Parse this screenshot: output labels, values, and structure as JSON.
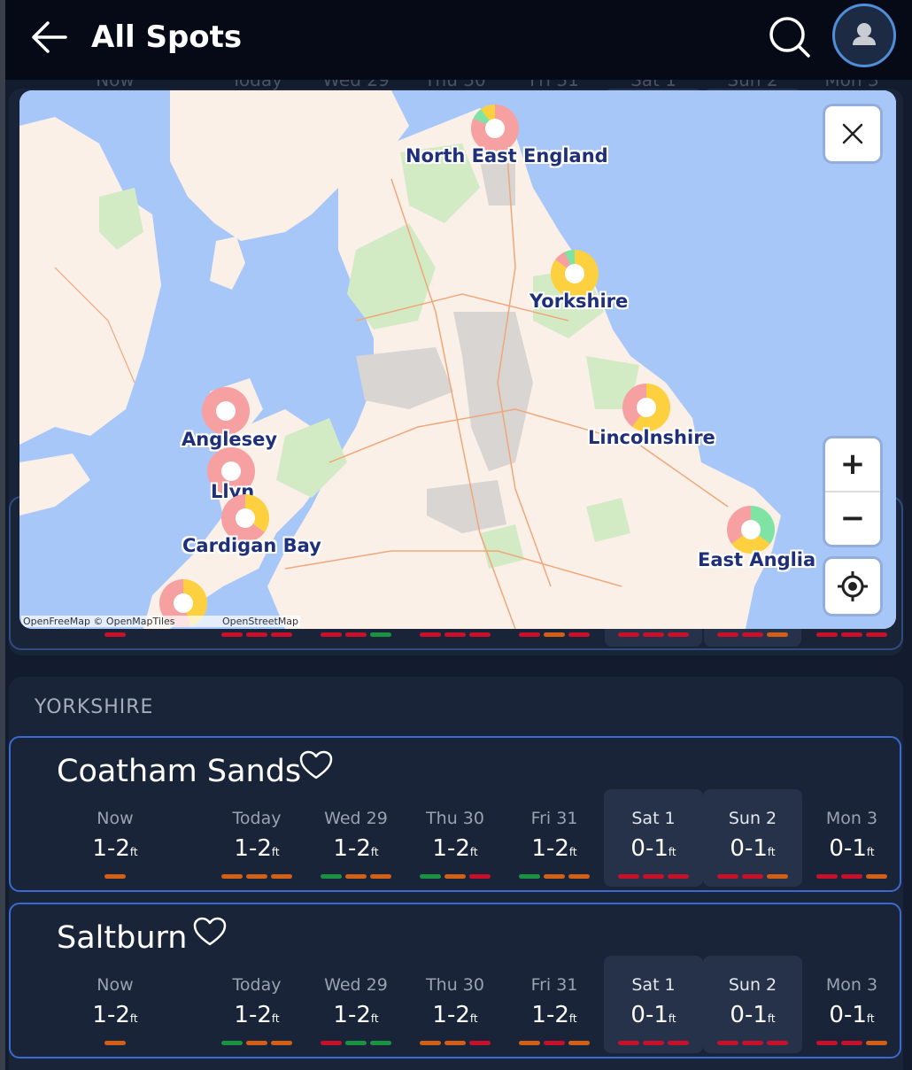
{
  "header": {
    "title": "All Spots"
  },
  "day_columns": [
    "Now",
    "Today",
    "Wed 29",
    "Thu 30",
    "Fri 31",
    "Sat 1",
    "Sun 2",
    "Mon 3"
  ],
  "colors": {
    "red": "#c8102a",
    "orange": "#d35f14",
    "green": "#1a9340",
    "marker_pink": "#f7a0a2",
    "marker_yellow": "#fcd03f",
    "marker_green": "#7fe3a4",
    "accent": "#3a6ad0"
  },
  "prev_group_bars": [
    [
      "red"
    ],
    [
      "red",
      "red",
      "red"
    ],
    [
      "red",
      "red",
      "green"
    ],
    [
      "red",
      "red",
      "red"
    ],
    [
      "red",
      "orange",
      "red"
    ],
    [
      "red",
      "red",
      "red"
    ],
    [
      "red",
      "red",
      "orange"
    ],
    [
      "red",
      "red",
      "red"
    ]
  ],
  "map": {
    "close_icon": "close-icon",
    "zoom_in_label": "+",
    "zoom_out_label": "−",
    "attribution_left": "OpenFreeMap © OpenMapTiles",
    "attribution_right": "OpenStreetMap",
    "regions": [
      {
        "name": "North East England",
        "pie": [
          [
            "marker_pink",
            0.82
          ],
          [
            "marker_green",
            0.08
          ],
          [
            "marker_yellow",
            0.1
          ]
        ]
      },
      {
        "name": "Yorkshire",
        "pie": [
          [
            "marker_yellow",
            0.85
          ],
          [
            "marker_pink",
            0.08
          ],
          [
            "marker_green",
            0.07
          ]
        ]
      },
      {
        "name": "Lincolnshire",
        "pie": [
          [
            "marker_yellow",
            0.6
          ],
          [
            "marker_pink",
            0.4
          ]
        ]
      },
      {
        "name": "Anglesey",
        "pie": [
          [
            "marker_pink",
            1.0
          ]
        ]
      },
      {
        "name": "Llyn",
        "pie": [
          [
            "marker_pink",
            1.0
          ]
        ]
      },
      {
        "name": "Cardigan Bay",
        "pie": [
          [
            "marker_yellow",
            0.35
          ],
          [
            "marker_pink",
            0.65
          ]
        ]
      },
      {
        "name": "East Anglia",
        "pie": [
          [
            "marker_green",
            0.35
          ],
          [
            "marker_yellow",
            0.3
          ],
          [
            "marker_pink",
            0.35
          ]
        ]
      },
      {
        "name": "",
        "pie": [
          [
            "marker_yellow",
            0.45
          ],
          [
            "marker_pink",
            0.55
          ]
        ]
      }
    ]
  },
  "group": {
    "label": "YORKSHIRE",
    "spots": [
      {
        "name": "Coatham Sands",
        "days": [
          {
            "day": "Now",
            "height": "1-2",
            "unit": "ft",
            "bars": [
              "orange"
            ]
          },
          {
            "day": "Today",
            "height": "1-2",
            "unit": "ft",
            "bars": [
              "orange",
              "orange",
              "orange"
            ]
          },
          {
            "day": "Wed 29",
            "height": "1-2",
            "unit": "ft",
            "bars": [
              "green",
              "orange",
              "orange"
            ]
          },
          {
            "day": "Thu 30",
            "height": "1-2",
            "unit": "ft",
            "bars": [
              "green",
              "orange",
              "red"
            ]
          },
          {
            "day": "Fri 31",
            "height": "1-2",
            "unit": "ft",
            "bars": [
              "green",
              "orange",
              "orange"
            ]
          },
          {
            "day": "Sat 1",
            "height": "0-1",
            "unit": "ft",
            "bars": [
              "red",
              "red",
              "red"
            ],
            "selected": true
          },
          {
            "day": "Sun 2",
            "height": "0-1",
            "unit": "ft",
            "bars": [
              "red",
              "red",
              "orange"
            ],
            "selected": true
          },
          {
            "day": "Mon 3",
            "height": "0-1",
            "unit": "ft",
            "bars": [
              "red",
              "red",
              "orange"
            ]
          }
        ]
      },
      {
        "name": "Saltburn",
        "days": [
          {
            "day": "Now",
            "height": "1-2",
            "unit": "ft",
            "bars": [
              "orange"
            ]
          },
          {
            "day": "Today",
            "height": "1-2",
            "unit": "ft",
            "bars": [
              "green",
              "orange",
              "orange"
            ]
          },
          {
            "day": "Wed 29",
            "height": "1-2",
            "unit": "ft",
            "bars": [
              "red",
              "green",
              "green"
            ]
          },
          {
            "day": "Thu 30",
            "height": "1-2",
            "unit": "ft",
            "bars": [
              "orange",
              "orange",
              "red"
            ]
          },
          {
            "day": "Fri 31",
            "height": "1-2",
            "unit": "ft",
            "bars": [
              "orange",
              "red",
              "orange"
            ]
          },
          {
            "day": "Sat 1",
            "height": "0-1",
            "unit": "ft",
            "bars": [
              "red",
              "red",
              "red"
            ],
            "selected": true
          },
          {
            "day": "Sun 2",
            "height": "0-1",
            "unit": "ft",
            "bars": [
              "red",
              "red",
              "red"
            ],
            "selected": true
          },
          {
            "day": "Mon 3",
            "height": "0-1",
            "unit": "ft",
            "bars": [
              "red",
              "red",
              "orange"
            ]
          }
        ]
      }
    ]
  }
}
